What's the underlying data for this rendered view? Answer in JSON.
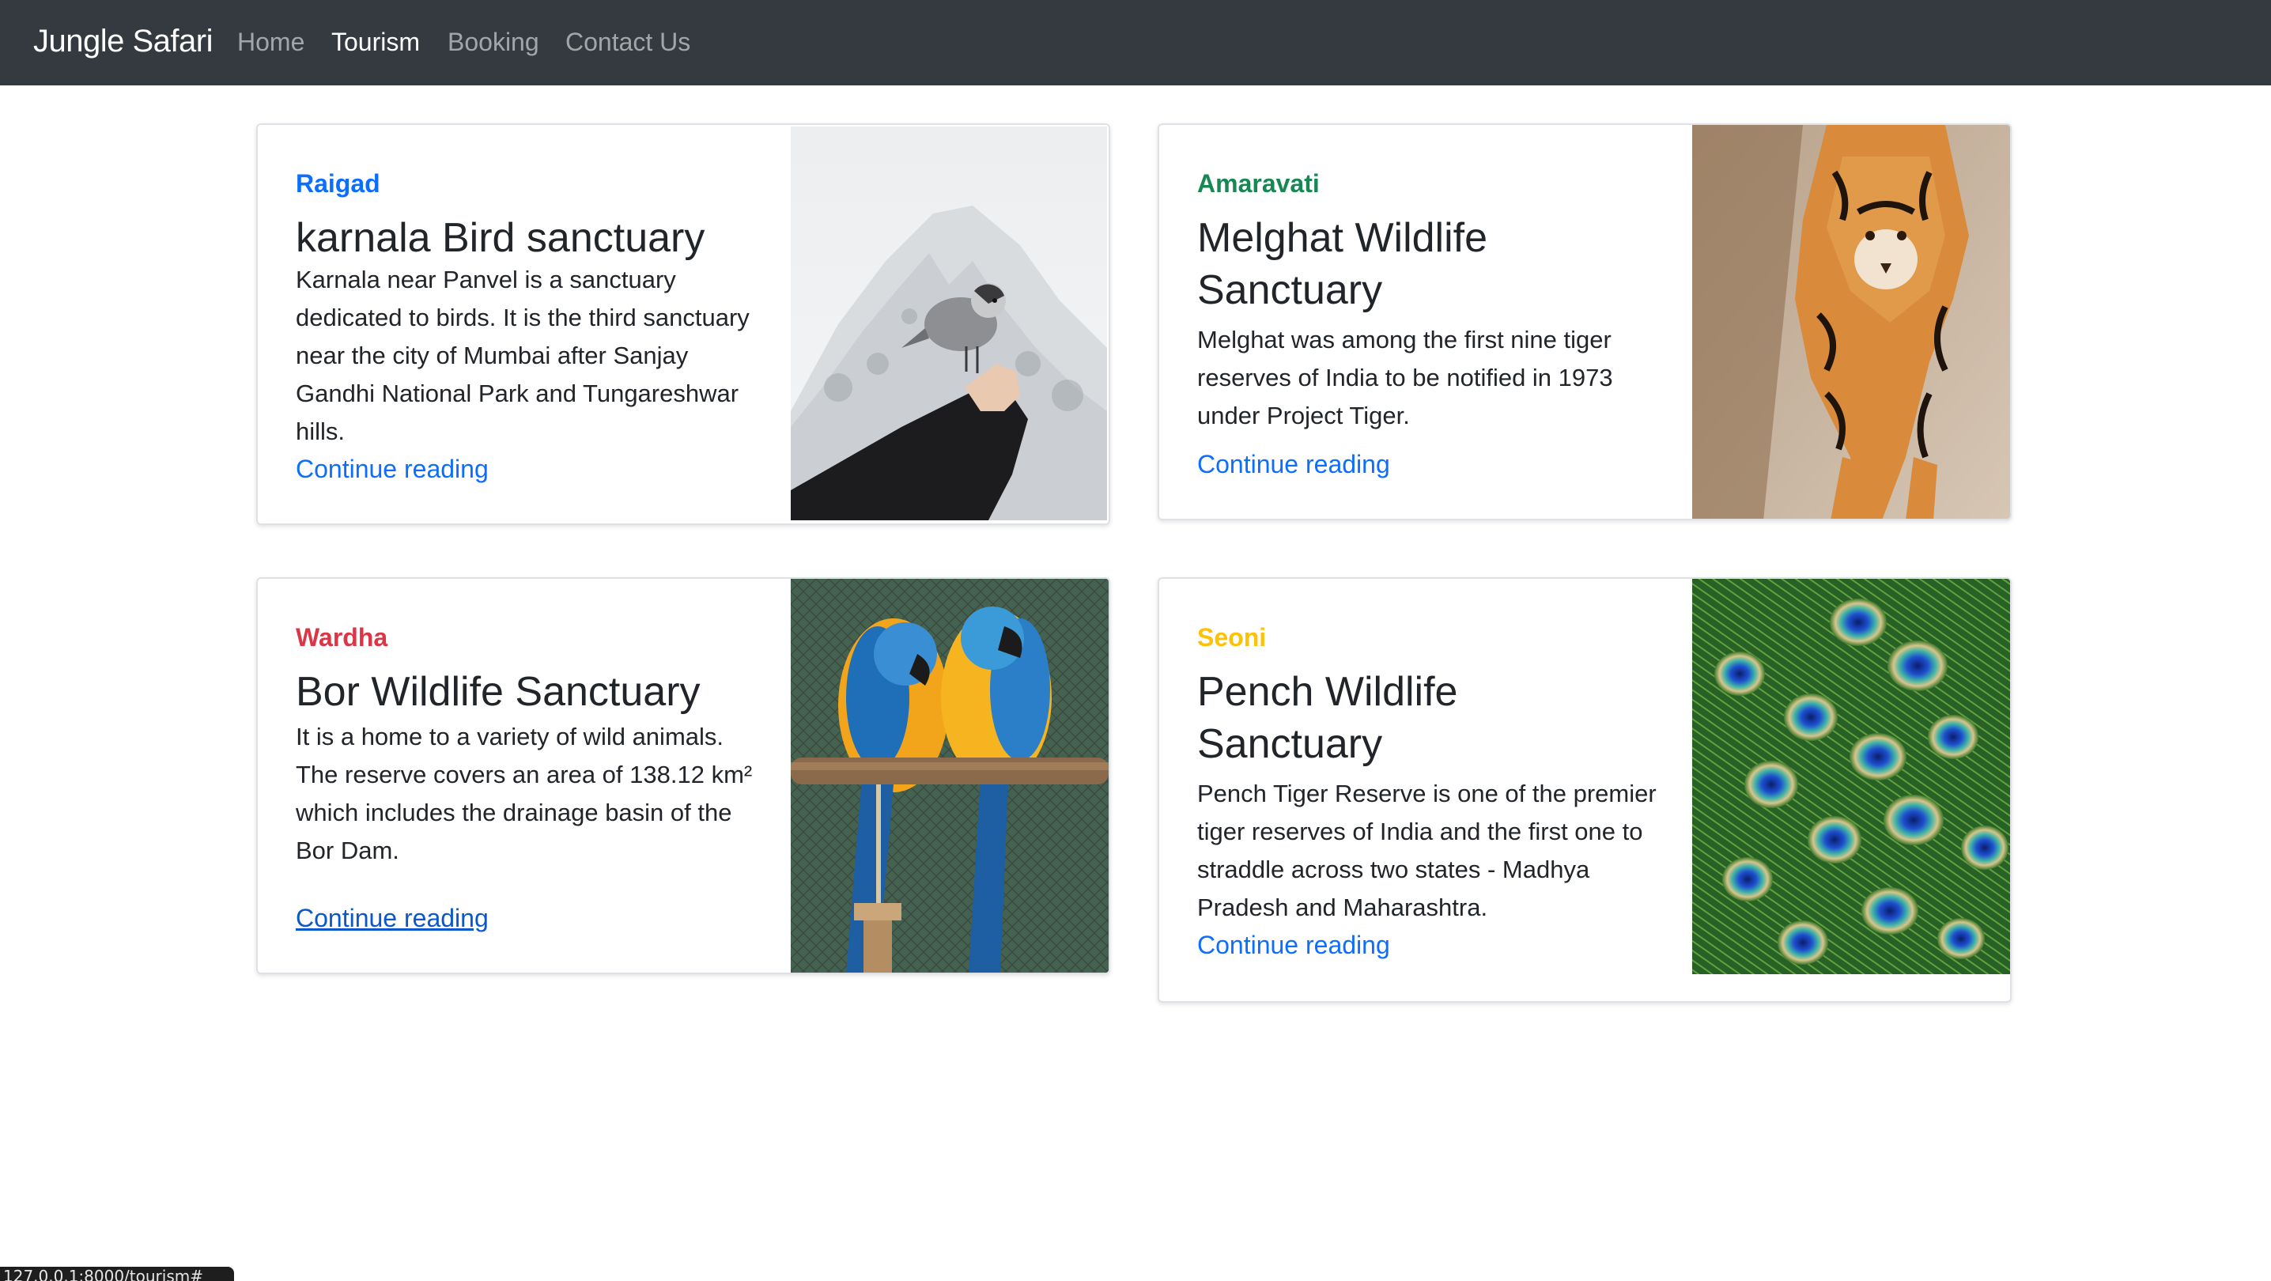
{
  "navbar": {
    "brand": "Jungle Safari",
    "links": [
      {
        "label": "Home",
        "active": false
      },
      {
        "label": "Tourism",
        "active": true
      },
      {
        "label": "Booking",
        "active": false
      },
      {
        "label": "Contact Us",
        "active": false
      }
    ]
  },
  "cards": [
    {
      "region": "Raigad",
      "region_color": "#0d6efd",
      "title": "karnala Bird sanctuary",
      "text": "Karnala near Panvel is a sanctuary dedicated to birds. It is the third sanctuary near the city of Mumbai after Sanjay Gandhi National Park and Tungareshwar hills.",
      "link": "Continue reading",
      "image": "snow-bird-photo"
    },
    {
      "region": "Amaravati",
      "region_color": "#198754",
      "title": "Melghat Wildlife Sanctuary",
      "text": "Melghat was among the first nine tiger reserves of India to be notified in 1973 under Project Tiger.",
      "link": "Continue reading",
      "image": "tiger-photo"
    },
    {
      "region": "Wardha",
      "region_color": "#dc3545",
      "title": "Bor Wildlife Sanctuary",
      "text": "It is a home to a variety of wild animals. The reserve covers an area of 138.12 km² which includes the drainage basin of the Bor Dam.",
      "link": "Continue reading",
      "image": "macaw-parrots-photo"
    },
    {
      "region": "Seoni",
      "region_color": "#ffc107",
      "title": "Pench Wildlife Sanctuary",
      "text": "Pench Tiger Reserve is one of the premier tiger reserves of India and the first one to straddle across two states - Madhya Pradesh and Maharashtra.",
      "link": "Continue reading",
      "image": "peacock-feathers-photo"
    }
  ],
  "statusbar": {
    "url": "127.0.0.1:8000/tourism#"
  }
}
